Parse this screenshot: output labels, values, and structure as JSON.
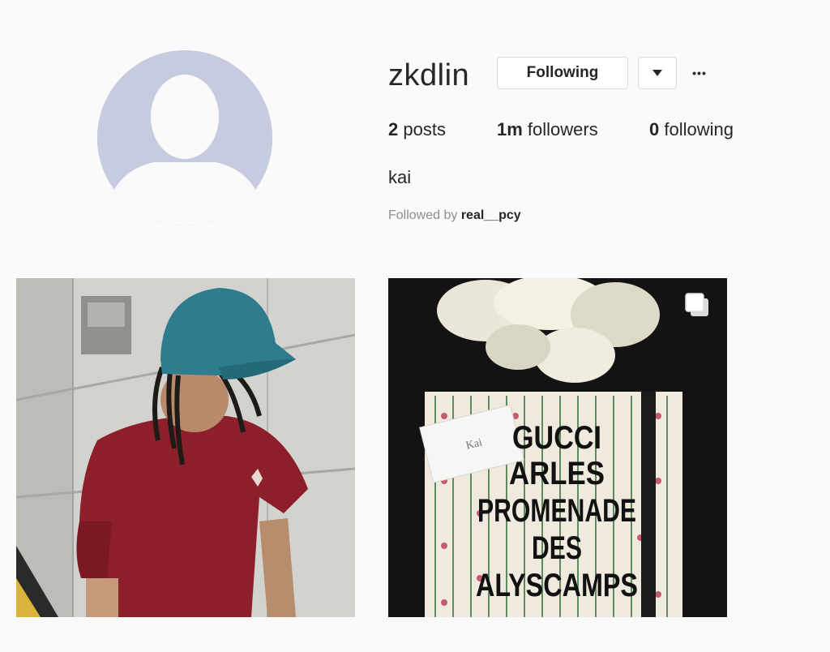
{
  "profile": {
    "username": "zkdlin",
    "following_button": "Following",
    "dropdown_icon": "chevron-down-icon",
    "more_icon": "more-options-icon",
    "more_glyph": "•••",
    "avatar_icon": "default-avatar-silhouette",
    "full_name": "kai",
    "followed_by_prefix": "Followed by",
    "followed_by_user": "real__pcy"
  },
  "stats": {
    "posts_count": "2",
    "posts_label": " posts",
    "followers_count": "1m",
    "followers_label": " followers",
    "following_count": "0",
    "following_label": " following"
  },
  "posts": [
    {
      "id": "post-1",
      "type": "photo",
      "description_icon": "photo-man-red-shirt-blue-cap"
    },
    {
      "id": "post-2",
      "type": "gallery",
      "gallery_icon": "multiple-photos-icon",
      "box_text": [
        "GUCCI",
        "ARLES",
        "PROMENADE",
        "DES",
        "ALYSCAMPS"
      ],
      "card_text": "Kai"
    }
  ]
}
